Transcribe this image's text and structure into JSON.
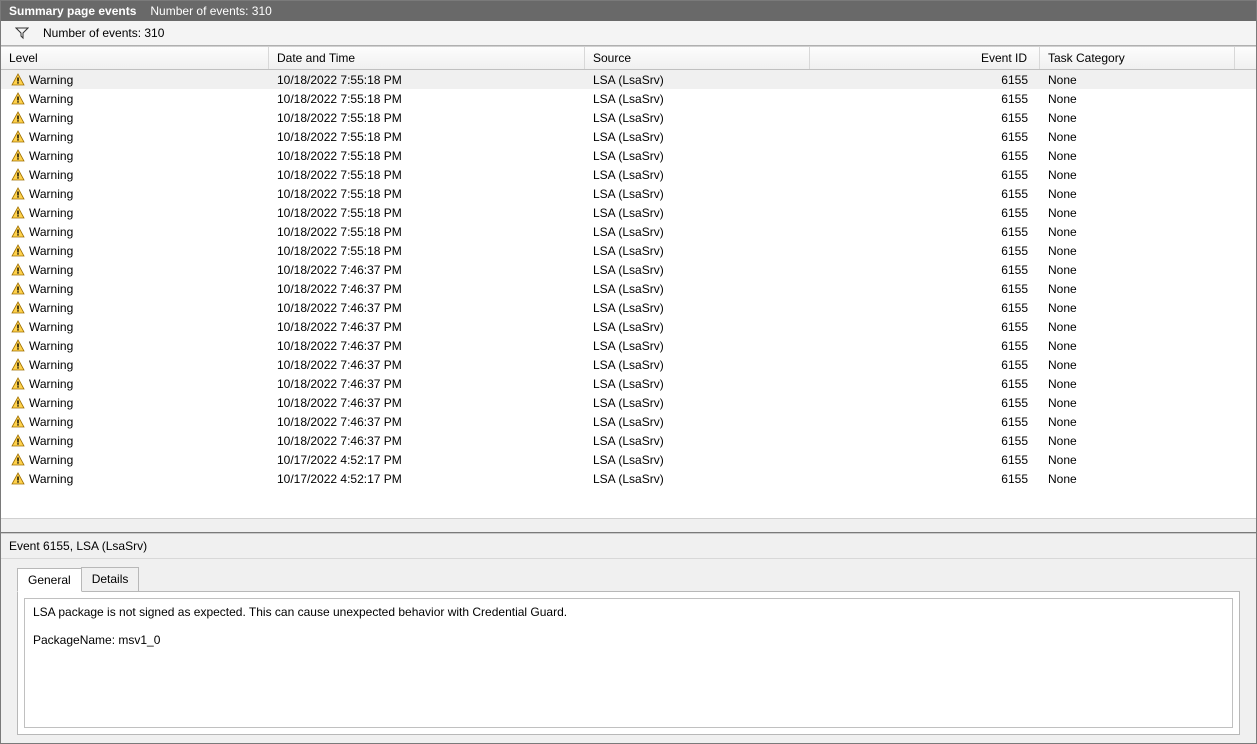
{
  "title": "Summary page events",
  "title_count_label": "Number of events: 310",
  "filter_count_label": "Number of events: 310",
  "columns": {
    "level": "Level",
    "date": "Date and Time",
    "source": "Source",
    "eventid": "Event ID",
    "task": "Task Category"
  },
  "events": [
    {
      "level": "Warning",
      "date": "10/18/2022 7:55:18 PM",
      "source": "LSA (LsaSrv)",
      "eventid": "6155",
      "task": "None",
      "selected": true
    },
    {
      "level": "Warning",
      "date": "10/18/2022 7:55:18 PM",
      "source": "LSA (LsaSrv)",
      "eventid": "6155",
      "task": "None"
    },
    {
      "level": "Warning",
      "date": "10/18/2022 7:55:18 PM",
      "source": "LSA (LsaSrv)",
      "eventid": "6155",
      "task": "None"
    },
    {
      "level": "Warning",
      "date": "10/18/2022 7:55:18 PM",
      "source": "LSA (LsaSrv)",
      "eventid": "6155",
      "task": "None"
    },
    {
      "level": "Warning",
      "date": "10/18/2022 7:55:18 PM",
      "source": "LSA (LsaSrv)",
      "eventid": "6155",
      "task": "None"
    },
    {
      "level": "Warning",
      "date": "10/18/2022 7:55:18 PM",
      "source": "LSA (LsaSrv)",
      "eventid": "6155",
      "task": "None"
    },
    {
      "level": "Warning",
      "date": "10/18/2022 7:55:18 PM",
      "source": "LSA (LsaSrv)",
      "eventid": "6155",
      "task": "None"
    },
    {
      "level": "Warning",
      "date": "10/18/2022 7:55:18 PM",
      "source": "LSA (LsaSrv)",
      "eventid": "6155",
      "task": "None"
    },
    {
      "level": "Warning",
      "date": "10/18/2022 7:55:18 PM",
      "source": "LSA (LsaSrv)",
      "eventid": "6155",
      "task": "None"
    },
    {
      "level": "Warning",
      "date": "10/18/2022 7:55:18 PM",
      "source": "LSA (LsaSrv)",
      "eventid": "6155",
      "task": "None"
    },
    {
      "level": "Warning",
      "date": "10/18/2022 7:46:37 PM",
      "source": "LSA (LsaSrv)",
      "eventid": "6155",
      "task": "None"
    },
    {
      "level": "Warning",
      "date": "10/18/2022 7:46:37 PM",
      "source": "LSA (LsaSrv)",
      "eventid": "6155",
      "task": "None"
    },
    {
      "level": "Warning",
      "date": "10/18/2022 7:46:37 PM",
      "source": "LSA (LsaSrv)",
      "eventid": "6155",
      "task": "None"
    },
    {
      "level": "Warning",
      "date": "10/18/2022 7:46:37 PM",
      "source": "LSA (LsaSrv)",
      "eventid": "6155",
      "task": "None"
    },
    {
      "level": "Warning",
      "date": "10/18/2022 7:46:37 PM",
      "source": "LSA (LsaSrv)",
      "eventid": "6155",
      "task": "None"
    },
    {
      "level": "Warning",
      "date": "10/18/2022 7:46:37 PM",
      "source": "LSA (LsaSrv)",
      "eventid": "6155",
      "task": "None"
    },
    {
      "level": "Warning",
      "date": "10/18/2022 7:46:37 PM",
      "source": "LSA (LsaSrv)",
      "eventid": "6155",
      "task": "None"
    },
    {
      "level": "Warning",
      "date": "10/18/2022 7:46:37 PM",
      "source": "LSA (LsaSrv)",
      "eventid": "6155",
      "task": "None"
    },
    {
      "level": "Warning",
      "date": "10/18/2022 7:46:37 PM",
      "source": "LSA (LsaSrv)",
      "eventid": "6155",
      "task": "None"
    },
    {
      "level": "Warning",
      "date": "10/18/2022 7:46:37 PM",
      "source": "LSA (LsaSrv)",
      "eventid": "6155",
      "task": "None"
    },
    {
      "level": "Warning",
      "date": "10/17/2022 4:52:17 PM",
      "source": "LSA (LsaSrv)",
      "eventid": "6155",
      "task": "None"
    },
    {
      "level": "Warning",
      "date": "10/17/2022 4:52:17 PM",
      "source": "LSA (LsaSrv)",
      "eventid": "6155",
      "task": "None"
    }
  ],
  "detail": {
    "header": "Event 6155, LSA (LsaSrv)",
    "tab_general": "General",
    "tab_details": "Details",
    "message": "LSA package is not signed as expected. This can cause unexpected behavior with Credential Guard.\n\nPackageName: msv1_0"
  }
}
